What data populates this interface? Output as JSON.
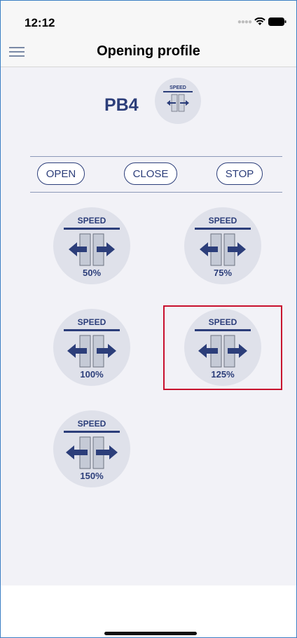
{
  "status_bar": {
    "time": "12:12"
  },
  "nav": {
    "title": "Opening profile"
  },
  "device": {
    "name": "PB4"
  },
  "speed_word": "SPEED",
  "actions": {
    "open": "OPEN",
    "close": "CLOSE",
    "stop": "STOP"
  },
  "speed_options": [
    {
      "label": "50%",
      "selected": false
    },
    {
      "label": "75%",
      "selected": false
    },
    {
      "label": "100%",
      "selected": false
    },
    {
      "label": "125%",
      "selected": true
    },
    {
      "label": "150%",
      "selected": false
    }
  ],
  "colors": {
    "accent": "#2c3e7a",
    "selection": "#c8102e",
    "circle": "#dfe1ea"
  }
}
